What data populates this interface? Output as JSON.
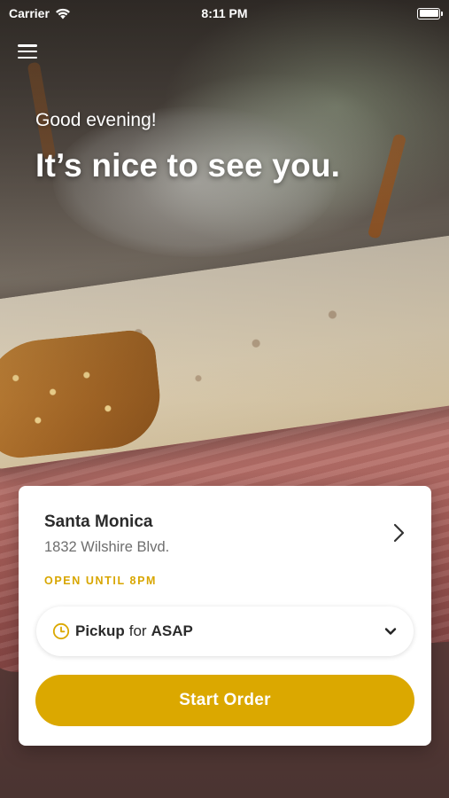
{
  "status_bar": {
    "carrier": "Carrier",
    "time": "8:11 PM"
  },
  "header": {
    "menu_icon": "hamburger-menu-icon",
    "greeting": "Good evening!",
    "headline": "It’s nice to see you."
  },
  "location": {
    "name": "Santa Monica",
    "address": "1832 Wilshire Blvd.",
    "hours": "OPEN UNTIL 8PM",
    "hours_color": "#d8a600"
  },
  "order_mode": {
    "icon": "clock-icon",
    "mode": "Pickup",
    "connector": "for",
    "time": "ASAP"
  },
  "start_order": {
    "label": "Start Order",
    "color": "#dba800"
  }
}
